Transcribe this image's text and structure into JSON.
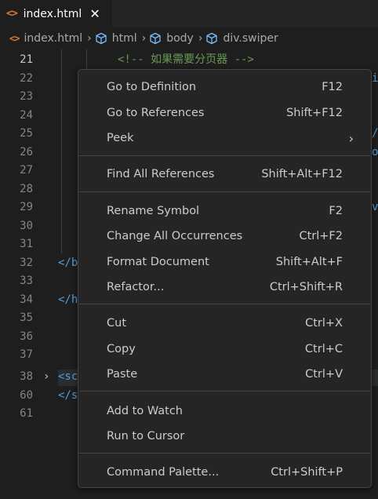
{
  "tab": {
    "icon": "<>",
    "name": "index.html",
    "close": "✕"
  },
  "breadcrumb": {
    "file": "index.html",
    "items": [
      "html",
      "body",
      "div.swiper"
    ]
  },
  "editor": {
    "lines": [
      {
        "n": "21",
        "active": true,
        "code": "<!-- 如果需要分页器 -->"
      },
      {
        "n": "22",
        "code": ""
      },
      {
        "n": "23",
        "code": ""
      },
      {
        "n": "24",
        "code": ""
      },
      {
        "n": "25",
        "code": ""
      },
      {
        "n": "26",
        "code": ""
      },
      {
        "n": "27",
        "code": ""
      },
      {
        "n": "28",
        "code": ""
      },
      {
        "n": "29",
        "code": ""
      },
      {
        "n": "30",
        "code": ""
      },
      {
        "n": "31",
        "code": ""
      },
      {
        "n": "32",
        "code": "</b"
      },
      {
        "n": "33",
        "code": ""
      },
      {
        "n": "34",
        "code": "</h"
      },
      {
        "n": "35",
        "code": ""
      },
      {
        "n": "36",
        "code": ""
      },
      {
        "n": "37",
        "code": ""
      },
      {
        "n": "38",
        "code": "<sc"
      },
      {
        "n": "60",
        "code": "</s"
      },
      {
        "n": "61",
        "code": ""
      }
    ],
    "right_fragments": {
      "l22": "i",
      "l25": "/",
      "l26": "o",
      "l29": "v"
    },
    "fold_icon": "›"
  },
  "menu": {
    "groups": [
      [
        {
          "label": "Go to Definition",
          "key": "F12"
        },
        {
          "label": "Go to References",
          "key": "Shift+F12"
        },
        {
          "label": "Peek",
          "key": "",
          "submenu": "›"
        }
      ],
      [
        {
          "label": "Find All References",
          "key": "Shift+Alt+F12"
        }
      ],
      [
        {
          "label": "Rename Symbol",
          "key": "F2"
        },
        {
          "label": "Change All Occurrences",
          "key": "Ctrl+F2"
        },
        {
          "label": "Format Document",
          "key": "Shift+Alt+F"
        },
        {
          "label": "Refactor...",
          "key": "Ctrl+Shift+R"
        }
      ],
      [
        {
          "label": "Cut",
          "key": "Ctrl+X"
        },
        {
          "label": "Copy",
          "key": "Ctrl+C"
        },
        {
          "label": "Paste",
          "key": "Ctrl+V"
        }
      ],
      [
        {
          "label": "Add to Watch",
          "key": ""
        },
        {
          "label": "Run to Cursor",
          "key": ""
        }
      ],
      [
        {
          "label": "Command Palette...",
          "key": "Ctrl+Shift+P"
        }
      ]
    ]
  },
  "colors": {
    "background": "#1e1e1e",
    "menu_background": "#252526",
    "comment": "#6a9955",
    "html_icon": "#e37933",
    "symbol_icon": "#75beff"
  }
}
